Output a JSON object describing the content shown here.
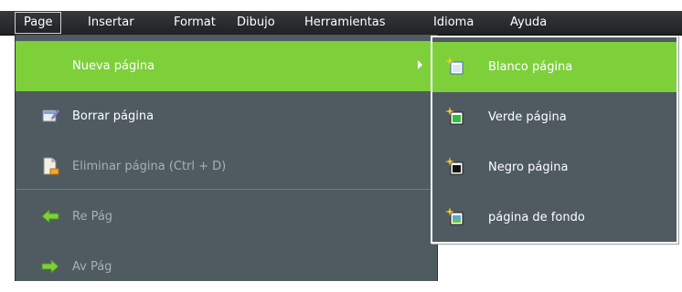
{
  "menubar": {
    "items": [
      {
        "label": "Page"
      },
      {
        "label": "Insertar"
      },
      {
        "label": "Format"
      },
      {
        "label": "Dibujo"
      },
      {
        "label": "Herramientas"
      },
      {
        "label": "Idioma"
      },
      {
        "label": "Ayuda"
      }
    ]
  },
  "page_menu": {
    "items": [
      {
        "label": "Nueva página",
        "icon": "new-page-icon",
        "highlighted": true,
        "has_submenu": true
      },
      {
        "label": "Borrar página",
        "icon": "erase-page-icon"
      },
      {
        "label": "Eliminar página (Ctrl + D)",
        "icon": "delete-page-icon",
        "disabled": true
      },
      {
        "label": "Re Pág",
        "icon": "arrow-left-icon",
        "disabled": true
      },
      {
        "label": "Av Pág",
        "icon": "arrow-right-icon",
        "disabled": true
      }
    ]
  },
  "submenu": {
    "items": [
      {
        "label": "Blanco página",
        "icon": "white-page-icon",
        "highlighted": true
      },
      {
        "label": "Verde página",
        "icon": "green-page-icon"
      },
      {
        "label": "Negro página",
        "icon": "black-page-icon"
      },
      {
        "label": "página de fondo",
        "icon": "background-page-icon"
      }
    ]
  },
  "colors": {
    "menubar_bg": "#2b2e31",
    "menu_bg": "#4f5a61",
    "highlight": "#7ed03b",
    "text": "#ffffff",
    "disabled_text": "#a6b0b6"
  }
}
